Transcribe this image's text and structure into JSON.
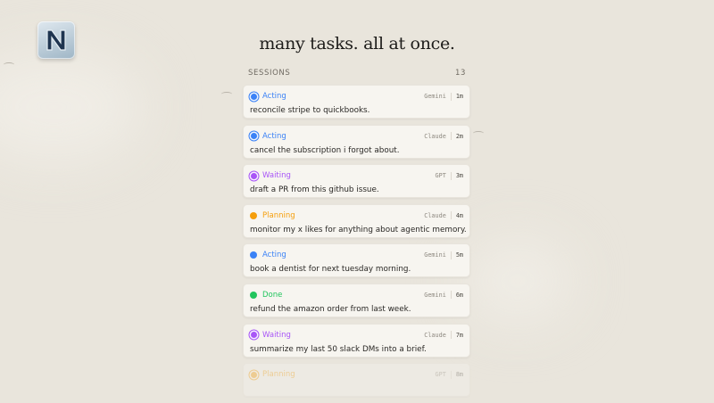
{
  "headline": "many tasks. all at once.",
  "sessions": {
    "label": "SESSIONS",
    "count": "13",
    "items": [
      {
        "status": "Acting",
        "color": "#3b82f6",
        "model": "Gemini",
        "age": "1m",
        "task": "reconcile stripe to quickbooks.",
        "ring": true
      },
      {
        "status": "Acting",
        "color": "#3b82f6",
        "model": "Claude",
        "age": "2m",
        "task": "cancel the subscription i forgot about.",
        "ring": true
      },
      {
        "status": "Waiting",
        "color": "#a855f7",
        "model": "GPT",
        "age": "3m",
        "task": "draft a PR from this github issue.",
        "ring": true
      },
      {
        "status": "Planning",
        "color": "#f59e0b",
        "model": "Claude",
        "age": "4m",
        "task": "monitor my x likes for anything about agentic memory.",
        "ring": false
      },
      {
        "status": "Acting",
        "color": "#3b82f6",
        "model": "Gemini",
        "age": "5m",
        "task": "book a dentist for next tuesday morning.",
        "ring": false
      },
      {
        "status": "Done",
        "color": "#22c55e",
        "model": "Gemini",
        "age": "6m",
        "task": "refund the amazon order from last week.",
        "ring": false
      },
      {
        "status": "Waiting",
        "color": "#a855f7",
        "model": "Claude",
        "age": "7m",
        "task": "summarize my last 50 slack DMs into a brief.",
        "ring": true
      },
      {
        "status": "Planning",
        "color": "#f59e0b",
        "model": "GPT",
        "age": "8m",
        "task": "",
        "ring": true
      }
    ]
  },
  "logo": {
    "icon": "app-logo-icon",
    "letter": "N"
  }
}
